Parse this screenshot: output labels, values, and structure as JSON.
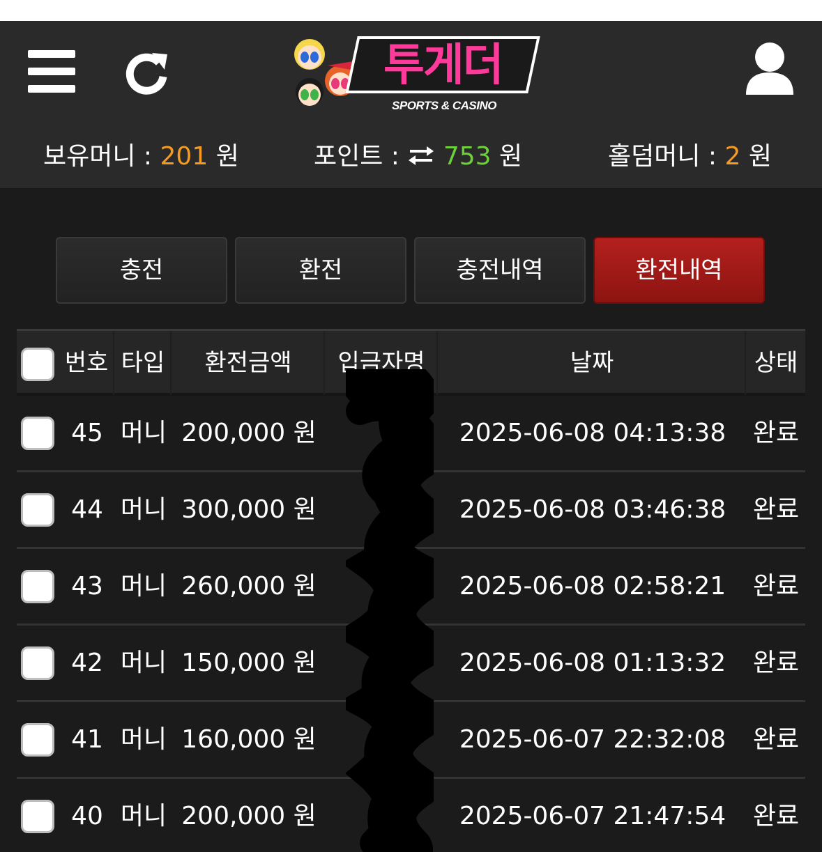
{
  "header": {
    "logo_title": "투게더",
    "logo_subtitle": "SPORTS & CASINO",
    "menu_icon": "hamburger-menu-icon",
    "refresh_icon": "refresh-icon",
    "user_icon": "user-icon"
  },
  "balances": {
    "money_label": "보유머니 :",
    "money_value": "201",
    "point_label": "포인트 :",
    "point_value": "753",
    "holdem_label": "홀덤머니 :",
    "holdem_value": "2",
    "unit": "원"
  },
  "tabs": [
    {
      "label": "충전",
      "active": false
    },
    {
      "label": "환전",
      "active": false
    },
    {
      "label": "충전내역",
      "active": false
    },
    {
      "label": "환전내역",
      "active": true
    }
  ],
  "table": {
    "headers": [
      "번호",
      "타입",
      "환전금액",
      "입금자명",
      "날짜",
      "상태"
    ],
    "rows": [
      {
        "no": "45",
        "type": "머니",
        "amount": "200,000 원",
        "name": "",
        "date": "2025-06-08 04:13:38",
        "status": "완료"
      },
      {
        "no": "44",
        "type": "머니",
        "amount": "300,000 원",
        "name": "",
        "date": "2025-06-08 03:46:38",
        "status": "완료"
      },
      {
        "no": "43",
        "type": "머니",
        "amount": "260,000 원",
        "name": "",
        "date": "2025-06-08 02:58:21",
        "status": "완료"
      },
      {
        "no": "42",
        "type": "머니",
        "amount": "150,000 원",
        "name": "",
        "date": "2025-06-08 01:13:32",
        "status": "완료"
      },
      {
        "no": "41",
        "type": "머니",
        "amount": "160,000 원",
        "name": "",
        "date": "2025-06-07 22:32:08",
        "status": "완료"
      },
      {
        "no": "40",
        "type": "머니",
        "amount": "200,000 원",
        "name": "",
        "date": "2025-06-07 21:47:54",
        "status": "완료"
      }
    ]
  },
  "colors": {
    "accent_orange": "#f59a23",
    "accent_green": "#6ed13a",
    "active_tab": "#a51a17",
    "logo_pink": "#ff3a9a"
  }
}
